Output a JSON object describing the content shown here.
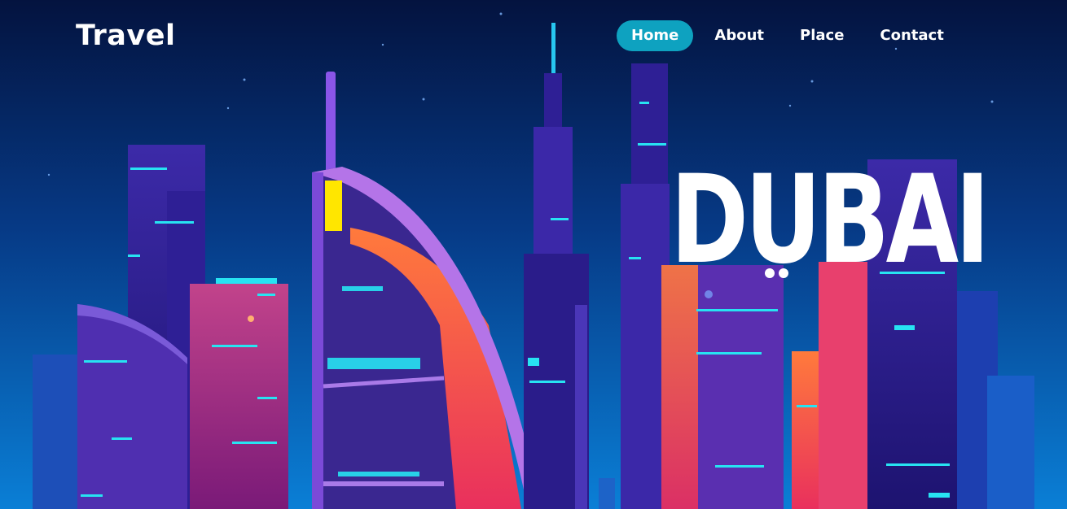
{
  "brand": {
    "title": "Travel"
  },
  "nav": {
    "items": [
      {
        "label": "Home",
        "active": true
      },
      {
        "label": "About",
        "active": false
      },
      {
        "label": "Place",
        "active": false
      },
      {
        "label": "Contact",
        "active": false
      }
    ]
  },
  "hero": {
    "city_label": "DUBAI"
  },
  "colors": {
    "accent": "#0ea2c0",
    "sky_top": "#041a4a",
    "sky_bottom": "#0a70c8",
    "text": "#ffffff"
  }
}
